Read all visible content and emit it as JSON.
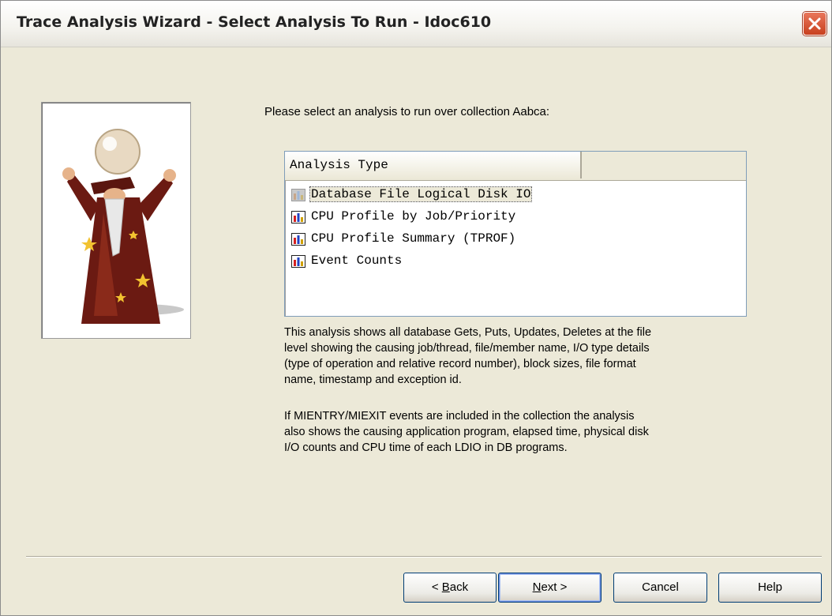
{
  "window": {
    "title": "Trace Analysis Wizard - Select Analysis To Run - Idoc610"
  },
  "prompt": "Please select an analysis to run over collection Aabca:",
  "listview": {
    "column_header": "Analysis Type",
    "items": [
      {
        "label": "Database File Logical Disk IO",
        "selected": true
      },
      {
        "label": "CPU Profile by Job/Priority",
        "selected": false
      },
      {
        "label": "CPU Profile Summary (TPROF)",
        "selected": false
      },
      {
        "label": "Event Counts",
        "selected": false
      }
    ]
  },
  "description": {
    "paragraph1_lines": [
      "This analysis shows all database Gets, Puts, Updates, Deletes at the file",
      "level showing the causing job/thread, file/member name, I/O type details",
      "(type of operation and relative record number), block sizes, file format",
      "name, timestamp and exception id."
    ],
    "paragraph2_lines": [
      "If MIENTRY/MIEXIT events are included in the collection the analysis",
      "also shows the causing application program, elapsed time, physical disk",
      "I/O counts and CPU time of each LDIO in DB programs."
    ]
  },
  "buttons": {
    "back_mnemonic": "B",
    "back_rest": "ack",
    "back_prefix": "< ",
    "next_mnemonic": "N",
    "next_rest": "ext >",
    "cancel": "Cancel",
    "help": "Help"
  },
  "icons": {
    "close": "close-icon",
    "list_item": "chart-icon",
    "wizard": "wizard-illustration"
  },
  "colors": {
    "dialog_bg": "#ece9d8",
    "close_red": "#c8401e",
    "listview_border": "#7f9db9",
    "button_border": "#003c74"
  }
}
